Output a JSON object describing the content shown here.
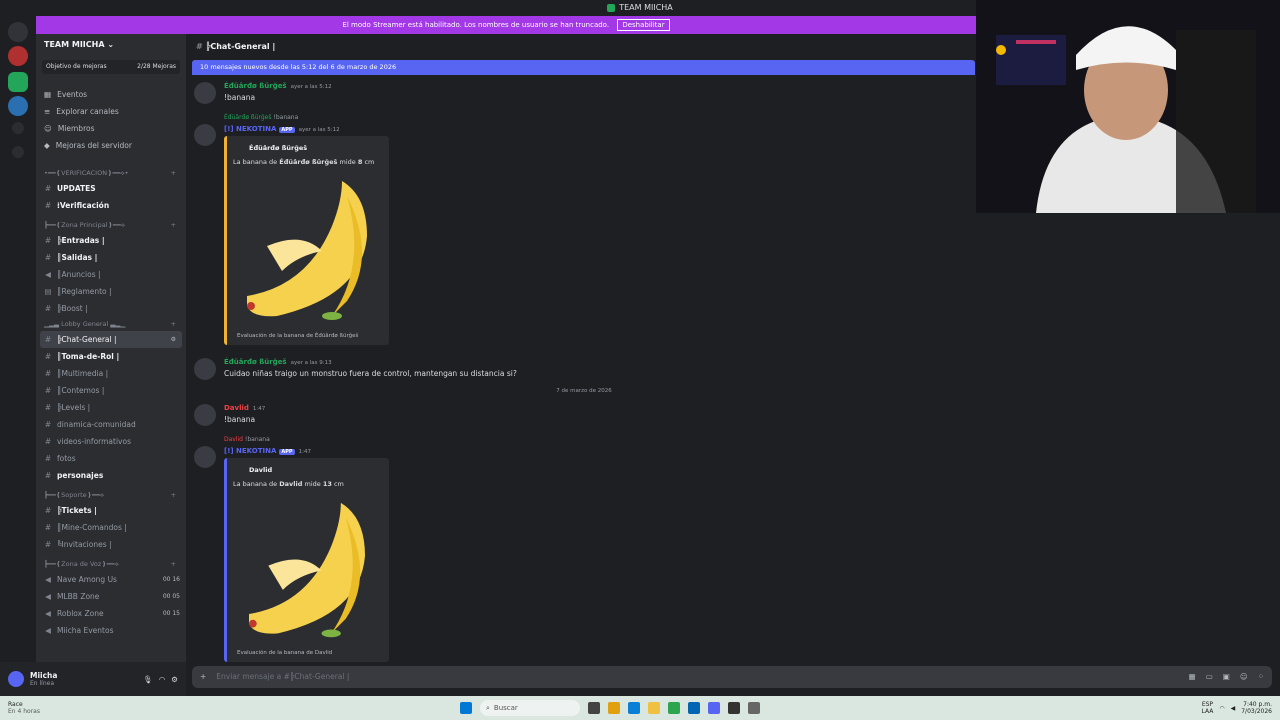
{
  "window": {
    "title": "TEAM MIICHA"
  },
  "banner": {
    "text": "El modo Streamer está habilitado. Los nombres de usuario se han truncado.",
    "button": "Deshabilitar"
  },
  "server": {
    "name": "TEAM MIICHA",
    "goal_label": "Objetivo de mejoras",
    "goal_value": "2/28 Mejoras"
  },
  "nav": {
    "events": "Eventos",
    "browse": "Explorar canales",
    "members": "Miembros",
    "boosts": "Mejoras del servidor"
  },
  "categories": {
    "verif": "•━━❪VERIFICACION❫━━⟡•",
    "principal": "┣━━❪Zona Principal❫━━⟡",
    "lobby": "▁▂▃ Lobby General ▃▂▁",
    "soporte": "┣━━❪Soporte❫━━⟡",
    "voz": "┣━━❪Zona de Voz❫━━⟡"
  },
  "channels": [
    {
      "name": "UPDATES",
      "unread": true
    },
    {
      "name": "⁞Verificación",
      "unread": true
    },
    {
      "name": "╠Entradas |",
      "unread": true
    },
    {
      "name": "║Salidas |",
      "unread": true
    },
    {
      "name": "║Anuncios |",
      "unread": false
    },
    {
      "name": "║Reglamento |",
      "unread": false
    },
    {
      "name": "╠Boost |",
      "unread": false
    },
    {
      "name": "╠Chat-General |",
      "unread": false
    },
    {
      "name": "║Toma-de-Rol |",
      "unread": true
    },
    {
      "name": "║Multimedia |",
      "unread": false
    },
    {
      "name": "║Contemos |",
      "unread": false
    },
    {
      "name": "╠Levels |",
      "unread": false
    },
    {
      "name": "dinamica-comunidad",
      "unread": false
    },
    {
      "name": "videos-informativos",
      "unread": false
    },
    {
      "name": "fotos",
      "unread": false
    },
    {
      "name": "personajes",
      "unread": true
    },
    {
      "name": "╠Tickets |",
      "unread": true
    },
    {
      "name": "║Mine-Comandos |",
      "unread": false
    },
    {
      "name": "╚Invitaciones |",
      "unread": false
    },
    {
      "name": "Nave Among Us",
      "unread": false
    },
    {
      "name": "MLBB Zone",
      "unread": false
    },
    {
      "name": "Roblox Zone",
      "unread": false
    },
    {
      "name": "Miicha Eventos",
      "unread": false
    }
  ],
  "voice_counts": {
    "among": "00 16",
    "mlbb": "00 05",
    "roblox": "00 15"
  },
  "user": {
    "name": "Miicha",
    "status": "En línea"
  },
  "chat": {
    "channel": "╠Chat-General |",
    "new_messages": "10 mensajes nuevos desde las 5:12 del 6 de marzo de 2026",
    "composer_placeholder": "Enviar mensaje a #╠Chat-General |",
    "date_divider": "7 de marzo de 2026"
  },
  "messages": [
    {
      "author": "Éđüârđø ßürğeš",
      "time": "ayer a las 5:12",
      "text": "!banana"
    },
    {
      "reply_author": "Éđüârđø ßürğeš",
      "reply_text": "!banana",
      "author": "[!] NEKOTINA",
      "tag": "APP",
      "time": "ayer a las 5:12",
      "embed_title": "Éđüârđø ßürğeš",
      "embed_text_1": "La banana de",
      "embed_text_bold": "Éđüârđø ßürğeš",
      "embed_text_2": "mide",
      "embed_size": "8",
      "embed_unit": "cm",
      "embed_footer": "Evaluación de la banana de Éđüârđø ßürğeš"
    },
    {
      "author": "Éđüârđø ßürğeš",
      "time": "ayer a las 9:13",
      "text": "Cuidao niñas traigo un monstruo fuera de control, mantengan su distancia si?"
    },
    {
      "author": "Davlid",
      "time": "1:47",
      "text": "!banana"
    },
    {
      "reply_author": "Davlid",
      "reply_text": "!banana",
      "author": "[!] NEKOTINA",
      "tag": "APP",
      "time": "1:47",
      "embed_title": "Davlid",
      "embed_text_1": "La banana de",
      "embed_text_bold": "Davlid",
      "embed_text_2": "mide",
      "embed_size": "13",
      "embed_unit": "cm",
      "embed_footer": "Evaluación de la banana de Davlid"
    }
  ],
  "taskbar": {
    "weather_title": "Race",
    "weather_sub": "En 4 horas",
    "search": "Buscar",
    "lang": "ESP",
    "lang2": "LAA",
    "time": "7:40 p.m.",
    "date": "7/03/2026"
  },
  "colors": {
    "accent": "#5865f2",
    "streamer_banner": "#a238e6",
    "green_name": "#23a55a",
    "red_name": "#f23f43",
    "bot_name": "#5865f2"
  }
}
